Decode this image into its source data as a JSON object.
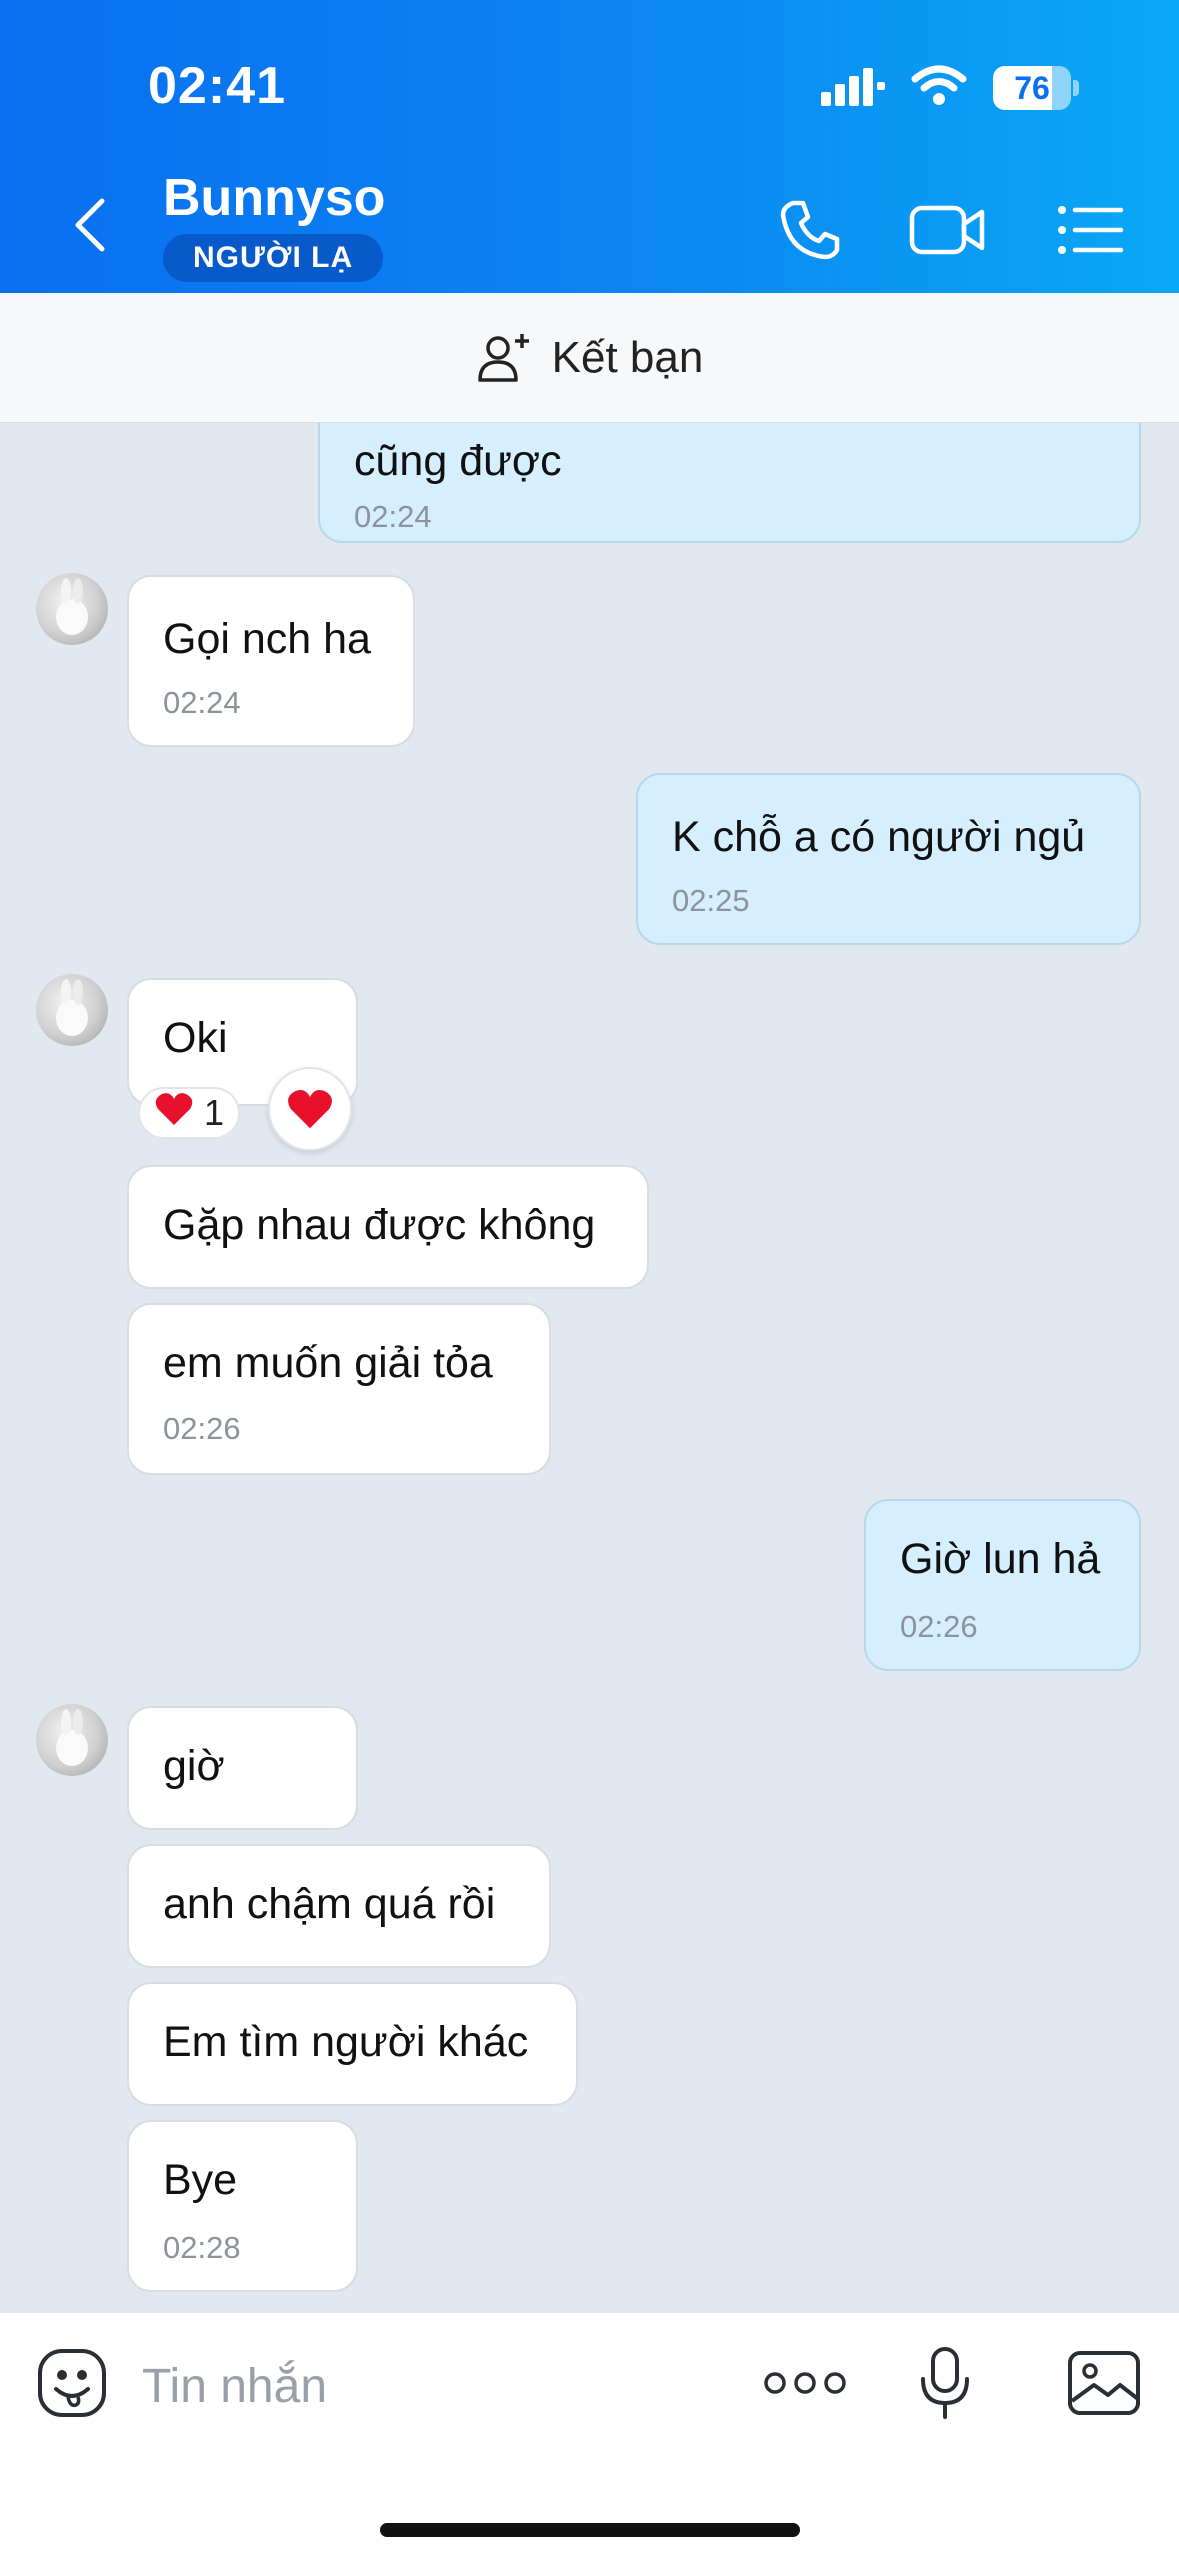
{
  "status_bar": {
    "time": "02:41",
    "battery": "76",
    "battery_level": 0.76
  },
  "header": {
    "contact_name": "Bunnyso",
    "badge": "NGƯỜI LẠ",
    "icons": [
      "back-icon",
      "phone-icon",
      "video-icon",
      "menu-list-icon"
    ]
  },
  "friend_bar": {
    "label": "Kết bạn",
    "icon": "add-person-icon"
  },
  "messages": [
    {
      "dir": "out",
      "text": "cũng được",
      "time": "02:24"
    },
    {
      "dir": "in",
      "text": "Gọi nch ha",
      "time": "02:24"
    },
    {
      "dir": "out",
      "text": "K chỗ a có người ngủ",
      "time": "02:25"
    },
    {
      "dir": "in",
      "text": "Oki",
      "reaction": {
        "emoji": "❤️",
        "count": "1"
      }
    },
    {
      "dir": "in",
      "text": "Gặp nhau được không"
    },
    {
      "dir": "in",
      "text": "em muốn giải tỏa",
      "time": "02:26"
    },
    {
      "dir": "out",
      "text": "Giờ lun hả",
      "time": "02:26"
    },
    {
      "dir": "in",
      "text": "giờ"
    },
    {
      "dir": "in",
      "text": "anh chậm quá rồi"
    },
    {
      "dir": "in",
      "text": "Em tìm người khác"
    },
    {
      "dir": "in",
      "text": "Bye",
      "time": "02:28"
    }
  ],
  "input_bar": {
    "placeholder": "Tin nhắn",
    "icons": [
      "emoji-sticker-icon",
      "more-options-icon",
      "microphone-icon",
      "image-icon"
    ]
  },
  "colors": {
    "header_gradient_start": "#0a6ff0",
    "header_gradient_end": "#0aa9f5",
    "chat_background": "#e2e8f0",
    "incoming_bubble": "#ffffff",
    "outgoing_bubble": "#d5efff",
    "badge": "#0859c9"
  }
}
